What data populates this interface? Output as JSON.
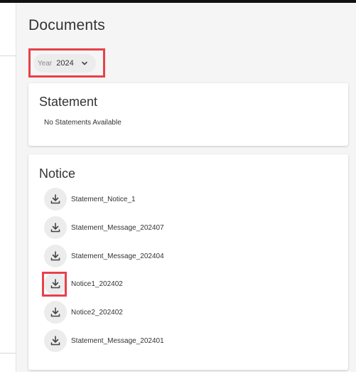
{
  "page": {
    "title": "Documents"
  },
  "year_filter": {
    "label": "Year",
    "value": "2024"
  },
  "statement_section": {
    "title": "Statement",
    "empty_message": "No Statements Available"
  },
  "notice_section": {
    "title": "Notice",
    "items": [
      {
        "name": "Statement_Notice_1"
      },
      {
        "name": "Statement_Message_202407"
      },
      {
        "name": "Statement_Message_202404"
      },
      {
        "name": "Notice1_202402"
      },
      {
        "name": "Notice2_202402"
      },
      {
        "name": "Statement_Message_202401"
      }
    ]
  },
  "colors": {
    "highlight": "#e8414a",
    "chip_bg": "#ececec",
    "text": "#333333"
  },
  "icons": {
    "download": "download-icon",
    "dropdown": "chevron-down-icon"
  }
}
